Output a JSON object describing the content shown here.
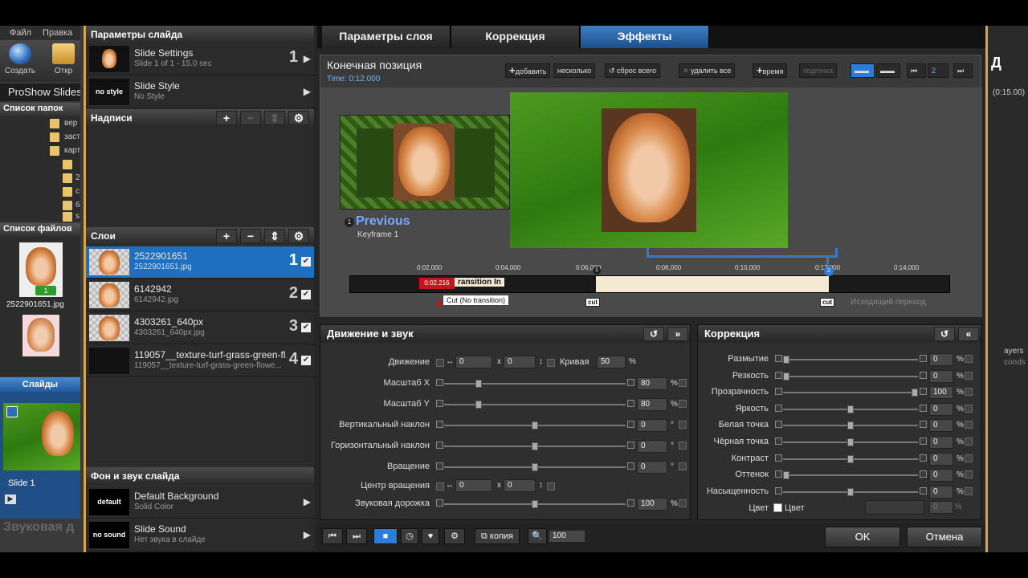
{
  "bg_app": {
    "menu": [
      "Файл",
      "Правка"
    ],
    "tools": [
      "Создать",
      "Откр"
    ],
    "title": "ProShow Slides",
    "folders_header": "Список папок",
    "folders": [
      "вер",
      "заст",
      "карт",
      "",
      "2",
      "с",
      "6",
      "s"
    ],
    "files_header": "Список файлов",
    "file_name": "2522901651.jpg",
    "file_badge": "1",
    "slides_tab": "Слайды",
    "slide_label": "Slide 1",
    "sound_label": "Звуковая д",
    "right_title": "Д",
    "right_time": "(0:15.00)",
    "right_layers": "ayers",
    "right_conds": "conds"
  },
  "left": {
    "slide_params_header": "Параметры слайда",
    "slide_settings": {
      "title": "Slide Settings",
      "sub": "Slide 1 of 1 - 15.0 sec",
      "num": "1"
    },
    "slide_style": {
      "thumb": "no style",
      "title": "Slide Style",
      "sub": "No Style"
    },
    "captions_header": "Надписи",
    "layers_header": "Слои",
    "layers": [
      {
        "title": "2522901651",
        "sub": "2522901651.jpg",
        "num": "1"
      },
      {
        "title": "6142942",
        "sub": "6142942.jpg",
        "num": "2"
      },
      {
        "title": "4303261_640px",
        "sub": "4303261_640px.jpg",
        "num": "3"
      },
      {
        "title": "119057__texture-turf-grass-green-fl...",
        "sub": "119057__texture-turf-grass-green-flowe...",
        "num": "4"
      }
    ],
    "bg_sound_header": "Фон и звук слайда",
    "bg": {
      "thumb": "default",
      "title": "Default Background",
      "sub": "Solid Color"
    },
    "sound": {
      "thumb": "no sound",
      "title": "Slide Sound",
      "sub": "Нет звука в слайде"
    }
  },
  "tabs": [
    "Параметры слоя",
    "Коррекция",
    "Эффекты"
  ],
  "preview": {
    "title": "Конечная позиция",
    "time": "Time: 0:12.000",
    "btn_add": "добавить",
    "btn_several": "несколько",
    "btn_reset": "сброс всего",
    "btn_delete": "удалить все",
    "btn_time": "время",
    "btn_fit": "подгонка",
    "kf_badge": "2",
    "previous_label": "Previous",
    "previous_sub": "Keyframe 1",
    "prev_marker": "1",
    "timeline_ticks": [
      "0:02,000",
      "0:04,000",
      "0:06,000",
      "0:08,000",
      "0:10,000",
      "0:12,000",
      "0:14,000"
    ],
    "tl_time": "0:02.216",
    "tl_transition": "ransition In",
    "tl_tooltip": "Cut (No transition)",
    "kf1": "1",
    "kf2": "2",
    "cut": "cut",
    "outgoing": "Исходящий переход"
  },
  "motion": {
    "header": "Движение и звук",
    "rows": [
      {
        "label": "Движение",
        "v1": "0",
        "x": "x",
        "v2": "0",
        "extra_label": "Кривая",
        "extra_val": "50",
        "unit": "%"
      },
      {
        "label": "Масштаб X",
        "value": "80",
        "unit": "%",
        "knob": 0.18
      },
      {
        "label": "Масштаб Y",
        "value": "80",
        "unit": "%",
        "knob": 0.18
      },
      {
        "label": "Вертикальный наклон",
        "value": "0",
        "unit": "°",
        "knob": 0.5
      },
      {
        "label": "Горизонтальный наклон",
        "value": "0",
        "unit": "°",
        "knob": 0.5
      },
      {
        "label": "Вращение",
        "value": "0",
        "unit": "°",
        "knob": 0.5
      },
      {
        "label": "Центр вращения",
        "v1": "0",
        "x": "x",
        "v2": "0"
      },
      {
        "label": "Звуковая дорожка",
        "value": "100",
        "unit": "%",
        "knob": 0.5
      }
    ]
  },
  "correction": {
    "header": "Коррекция",
    "rows": [
      {
        "label": "Размытие",
        "value": "0",
        "unit": "%",
        "knob": 0.0
      },
      {
        "label": "Резкость",
        "value": "0",
        "unit": "%",
        "knob": 0.0
      },
      {
        "label": "Прозрачность",
        "value": "100",
        "unit": "%",
        "knob": 1.0
      },
      {
        "label": "Яркость",
        "value": "0",
        "unit": "%",
        "knob": 0.5
      },
      {
        "label": "Белая точка",
        "value": "0",
        "unit": "%",
        "knob": 0.5
      },
      {
        "label": "Чёрная точка",
        "value": "0",
        "unit": "%",
        "knob": 0.5
      },
      {
        "label": "Контраст",
        "value": "0",
        "unit": "%",
        "knob": 0.5
      },
      {
        "label": "Оттенок",
        "value": "0",
        "unit": "%",
        "knob": 0.0
      },
      {
        "label": "Насыщенность",
        "value": "0",
        "unit": "%",
        "knob": 0.5
      }
    ],
    "color_label": "Цвет",
    "color_check_label": "Цвет",
    "color_value": "0",
    "color_unit": "%"
  },
  "footer": {
    "copy": "копия",
    "zoom": "100",
    "ok": "OK",
    "cancel": "Отмена"
  },
  "colors": {
    "accent": "#1f6fc1",
    "frame": "#d6a64d",
    "timeline_marker": "#c0161c"
  }
}
